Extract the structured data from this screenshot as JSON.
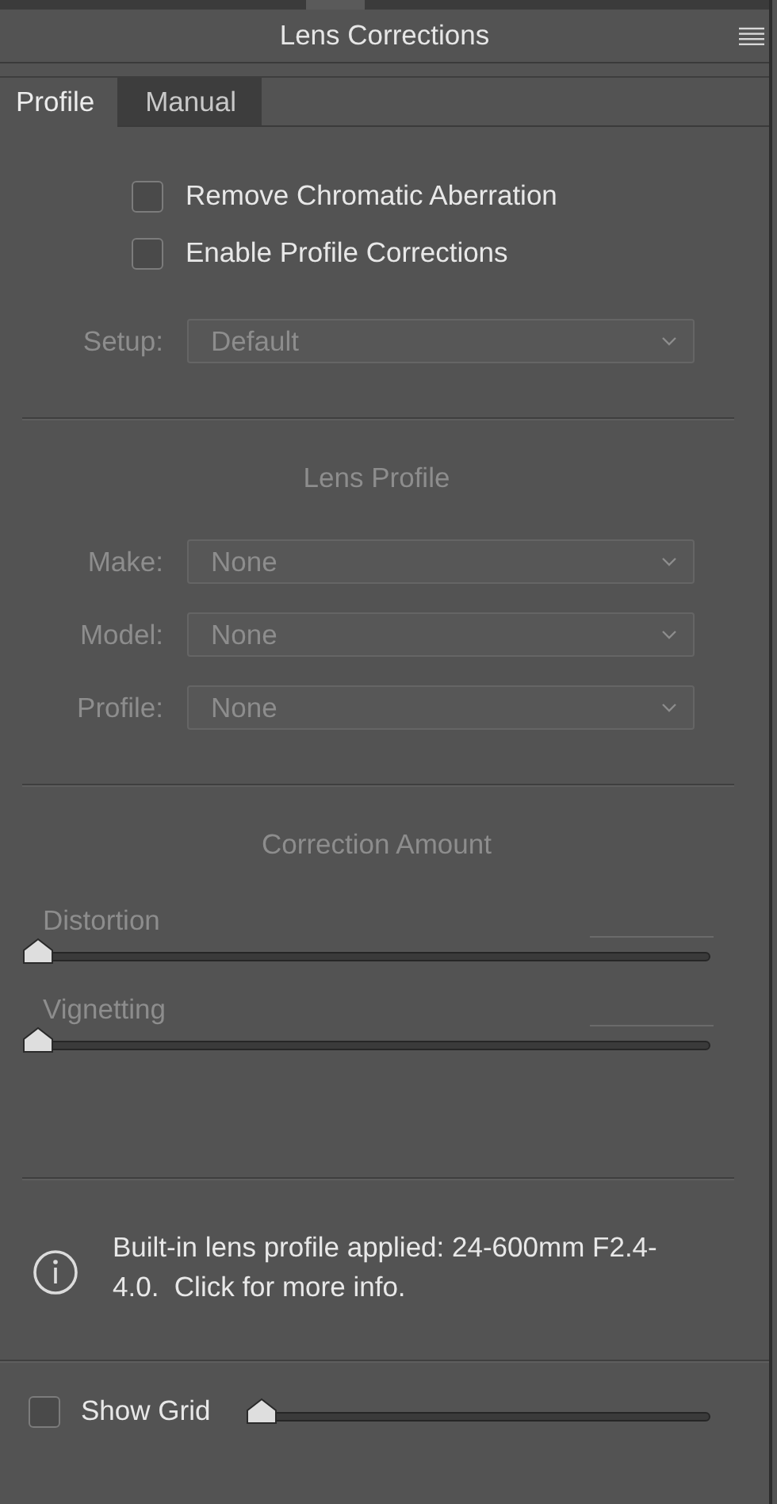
{
  "panel": {
    "title": "Lens Corrections"
  },
  "tabs": [
    {
      "label": "Profile",
      "selected": true
    },
    {
      "label": "Manual",
      "selected": false
    }
  ],
  "options": [
    {
      "label": "Remove Chromatic Aberration",
      "checked": false
    },
    {
      "label": "Enable Profile Corrections",
      "checked": false
    }
  ],
  "setup": {
    "label": "Setup:",
    "value": "Default",
    "disabled": true
  },
  "lens_profile": {
    "heading": "Lens Profile",
    "fields": [
      {
        "label": "Make:",
        "value": "None",
        "disabled": true
      },
      {
        "label": "Model:",
        "value": "None",
        "disabled": true
      },
      {
        "label": "Profile:",
        "value": "None",
        "disabled": true
      }
    ]
  },
  "correction_amount": {
    "heading": "Correction Amount",
    "sliders": [
      {
        "label": "Distortion",
        "level": 0,
        "disabled": true
      },
      {
        "label": "Vignetting",
        "level": 0,
        "disabled": true
      }
    ]
  },
  "info": {
    "text": "Built-in lens profile applied: 24-600mm F2.4-4.0.  Click for more info."
  },
  "show_grid": {
    "label": "Show Grid",
    "checked": false,
    "level": 0
  }
}
